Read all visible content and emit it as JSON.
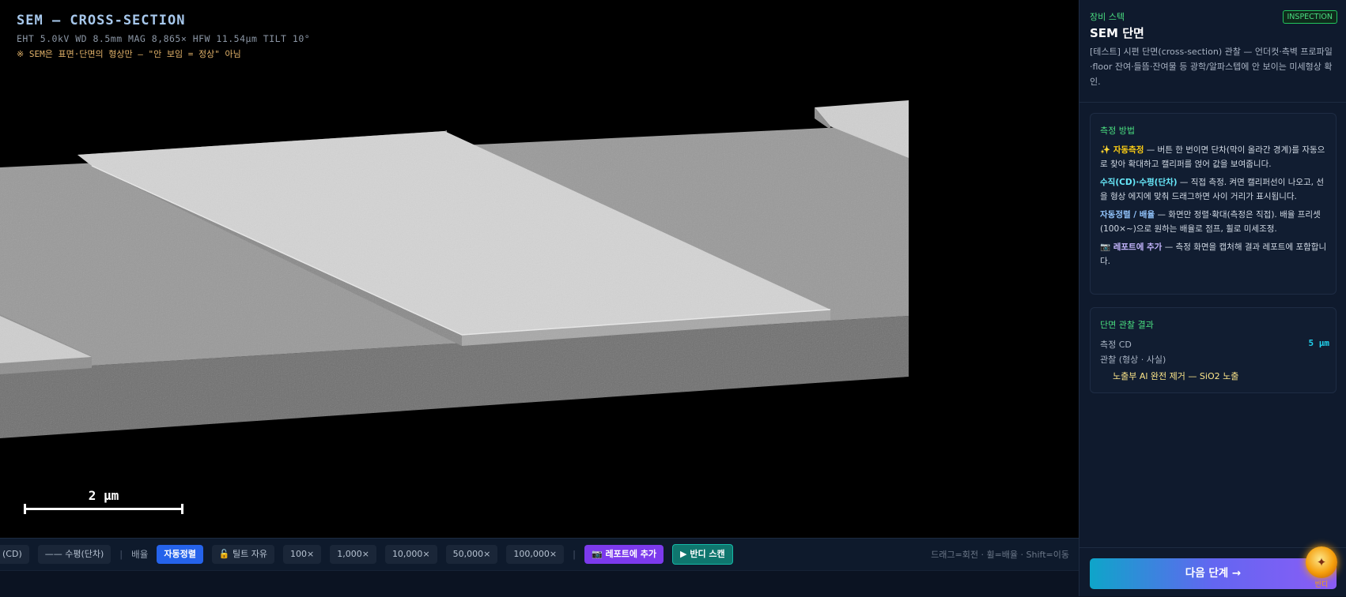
{
  "viewer": {
    "title": "SEM — CROSS-SECTION",
    "params": "EHT 5.0kV  WD 8.5mm  MAG 8,865×  HFW 11.54µm  TILT 10°",
    "note": "※ SEM은 표면·단면의 형상만 — \"안 보임 = 정상\" 아님",
    "scalebar_label": "2 µm"
  },
  "toolbar": {
    "cd_partial": "(CD)",
    "horizontal_label": "—— 수평(단차)",
    "mag_label": "배율",
    "auto_align": "자동정렬",
    "tilt_free": "🔓 틸트 자유",
    "mag_presets": [
      "100×",
      "1,000×",
      "10,000×",
      "50,000×",
      "100,000×"
    ],
    "add_report": "📷 레포트에 추가",
    "bandi_scan": "▶ 반디 스캔",
    "hint": "드래그=회전 · 휠=배율 · Shift=이동"
  },
  "panel": {
    "kicker": "장비 스텍",
    "badge": "INSPECTION",
    "title": "SEM 단면",
    "description": "[테스트] 시편 단면(cross-section) 관찰 — 언더컷·측벽 프로파일·floor 잔여·들뜸·잔여물 등 광학/알파스텝에 안 보이는 미세형상 확인.",
    "method": {
      "title": "측정 방법",
      "items": [
        {
          "keyword": "✨ 자동측정",
          "text": " — 버튼 한 번이면 단차(막이 올라간 경계)를 자동으로 찾아 확대하고 캘리퍼를 얹어 값을 보여줍니다."
        },
        {
          "keyword": "수직(CD)·수평(단차)",
          "text": " — 직접 측정. 켜면 캘리퍼선이 나오고, 선을 형상 에지에 맞춰 드래그하면 사이 거리가 표시됩니다."
        },
        {
          "keyword": "자동정렬 / 배율",
          "text": " — 화면만 정렬·확대(측정은 직접). 배율 프리셋(100×~)으로 원하는 배율로 점프, 휠로 미세조정."
        },
        {
          "keyword": "📷 레포트에 추가",
          "text": " — 측정 화면을 캡처해 결과 레포트에 포함합니다."
        }
      ]
    },
    "result": {
      "title": "단면 관찰 결과",
      "cd_label": "측정 CD",
      "cd_value": "5 µm",
      "obs_label": "관찰 (형상 · 사실)",
      "obs_value": "노출부 Al 완전 제거 — SiO2 노출"
    },
    "next_button": "다음 단계 →",
    "assistant_label": "반디",
    "assistant_glyph": "✦"
  },
  "colors": {
    "accent_green": "#4ade80",
    "accent_blue": "#2563eb",
    "accent_purple": "#7c3aed",
    "accent_teal": "#0f766e",
    "result_cyan": "#22d3ee"
  }
}
